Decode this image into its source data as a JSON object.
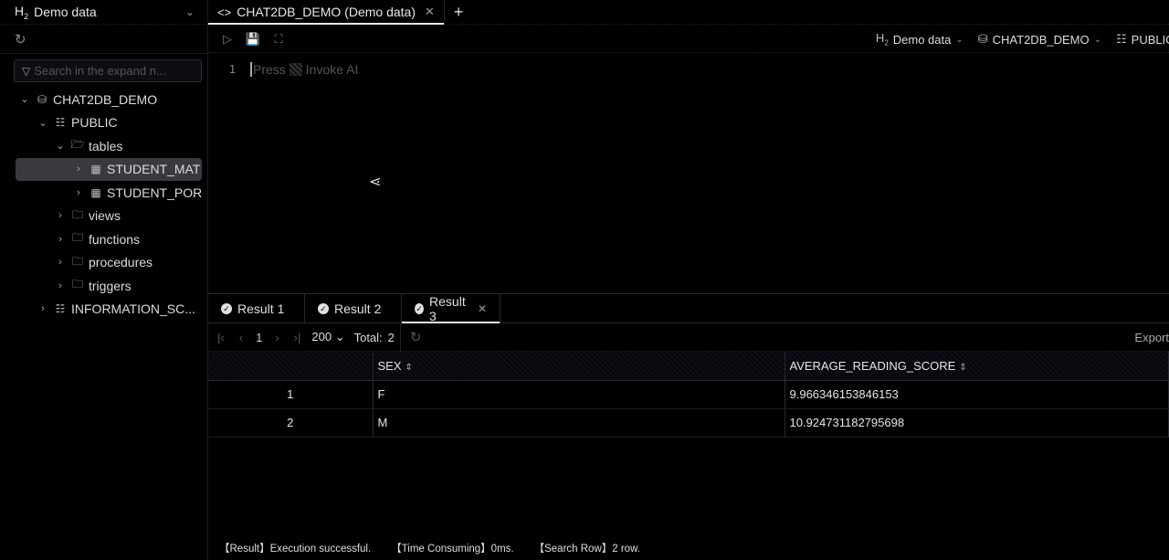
{
  "sidebar": {
    "datasource": {
      "prefix": "H",
      "prefix_sub": "2",
      "name": "Demo data"
    },
    "search_placeholder": "Search in the expand n...",
    "tree": [
      {
        "label": "CHAT2DB_DEMO",
        "icon": "database-icon",
        "expanded": true,
        "level": 0
      },
      {
        "label": "PUBLIC",
        "icon": "schema-icon",
        "expanded": true,
        "level": 1
      },
      {
        "label": "tables",
        "icon": "folder-open-icon",
        "expanded": true,
        "level": 2
      },
      {
        "label": "STUDENT_MAT",
        "icon": "table-icon",
        "expanded": false,
        "level": 3,
        "selected": true
      },
      {
        "label": "STUDENT_POR",
        "icon": "table-icon",
        "expanded": false,
        "level": 3
      },
      {
        "label": "views",
        "icon": "folder-icon",
        "expanded": false,
        "level": 2
      },
      {
        "label": "functions",
        "icon": "folder-icon",
        "expanded": false,
        "level": 2
      },
      {
        "label": "procedures",
        "icon": "folder-icon",
        "expanded": false,
        "level": 2
      },
      {
        "label": "triggers",
        "icon": "folder-icon",
        "expanded": false,
        "level": 2
      },
      {
        "label": "INFORMATION_SC...",
        "icon": "schema-icon",
        "expanded": false,
        "level": 1
      }
    ]
  },
  "tabs": [
    {
      "label": "CHAT2DB_DEMO (Demo data)",
      "active": true
    }
  ],
  "toolbar": {
    "context": {
      "datasource": "Demo data",
      "database": "CHAT2DB_DEMO",
      "schema": "PUBLIC"
    }
  },
  "editor": {
    "line_number": "1",
    "placeholder_press": "Press",
    "placeholder_action": "Invoke AI"
  },
  "results": {
    "tabs": [
      {
        "label": "Result 1",
        "active": false
      },
      {
        "label": "Result 2",
        "active": false
      },
      {
        "label": "Result 3",
        "active": true
      }
    ],
    "pager": {
      "current_page": "1",
      "page_size": "200",
      "total_label": "Total:",
      "total": "2",
      "export_label": "Export"
    },
    "columns": [
      "",
      "SEX",
      "AVERAGE_READING_SCORE"
    ],
    "rows": [
      [
        "1",
        "F",
        "9.966346153846153"
      ],
      [
        "2",
        "M",
        "10.924731182795698"
      ]
    ]
  },
  "status": {
    "result": "【Result】Execution successful.",
    "time": "【Time Consuming】0ms.",
    "rows": "【Search Row】2 row."
  }
}
